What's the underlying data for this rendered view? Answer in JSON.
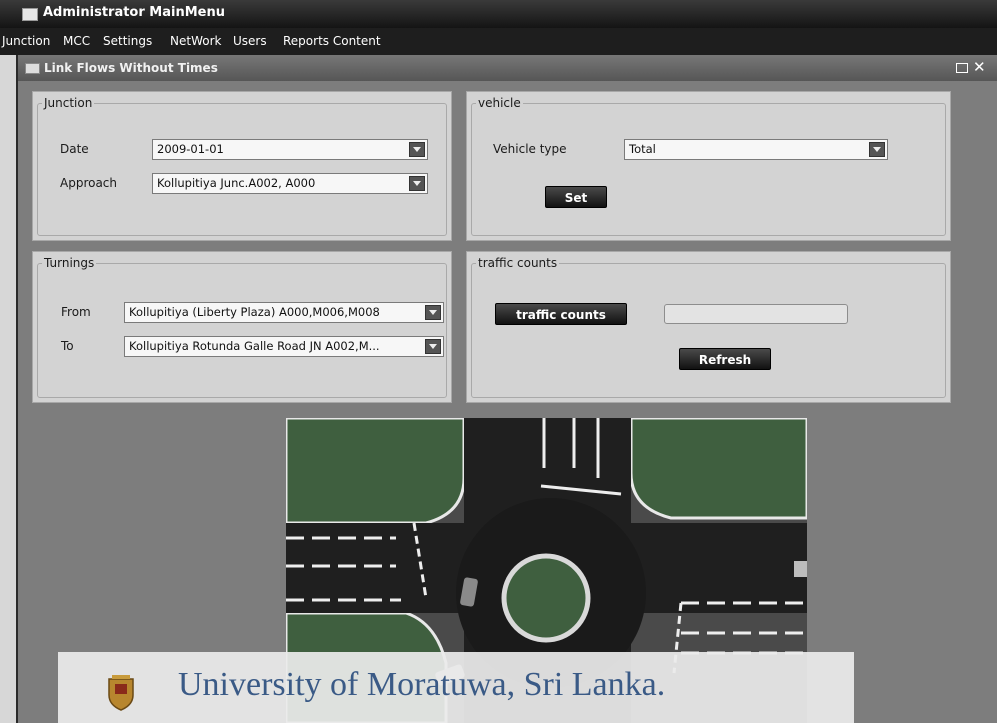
{
  "app": {
    "title": "Administrator MainMenu"
  },
  "menu": [
    "Junction",
    "MCC",
    "Settings",
    "NetWork",
    "Users",
    "Reports Content"
  ],
  "window": {
    "title": "Link Flows Without Times"
  },
  "junction": {
    "legend": "Junction",
    "date_label": "Date",
    "date_value": "2009-01-01",
    "approach_label": "Approach",
    "approach_value": "Kollupitiya Junc.A002, A000"
  },
  "vehicle": {
    "legend": "vehicle",
    "type_label": "Vehicle type",
    "type_value": "Total",
    "set_button": "Set"
  },
  "turnings": {
    "legend": "Turnings",
    "from_label": "From",
    "from_value": "Kollupitiya (Liberty Plaza) A000,M006,M008",
    "to_label": "To",
    "to_value": "Kollupitiya Rotunda Galle Road JN A002,M..."
  },
  "traffic": {
    "legend": "traffic counts",
    "counts_button": "traffic counts",
    "counts_value": "",
    "refresh_button": "Refresh"
  },
  "watermark": {
    "text": "University of Moratuwa, Sri Lanka."
  },
  "icons": {
    "window": "window-icon",
    "maximize": "maximize-icon",
    "close": "close-icon",
    "dropdown": "chevron-down-icon",
    "crest": "university-crest-icon"
  }
}
